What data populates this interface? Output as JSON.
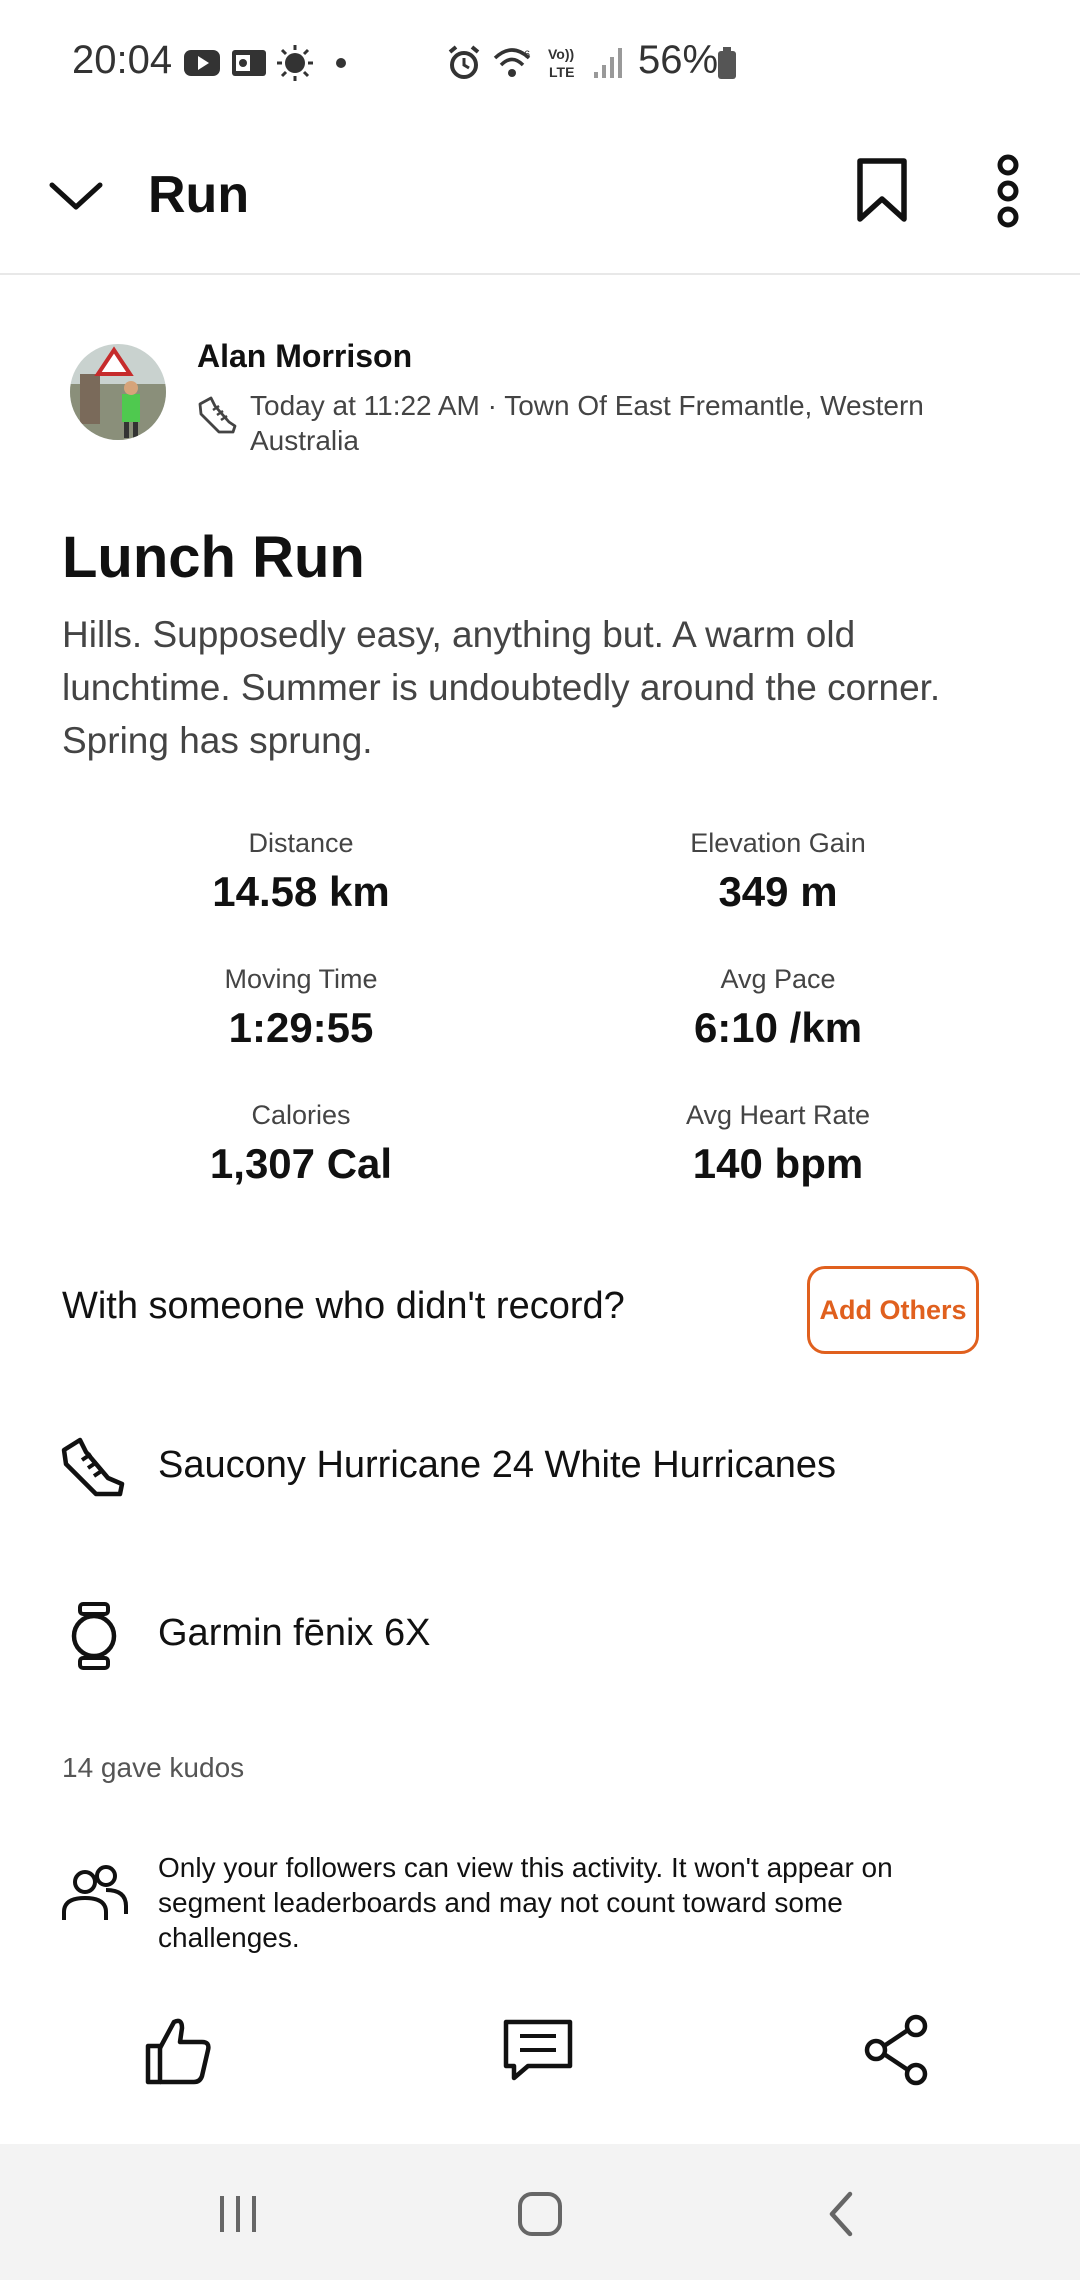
{
  "status_bar": {
    "time": "20:04",
    "battery_percent": "56%",
    "icons": [
      "youtube-icon",
      "outlook-icon",
      "weather-icon",
      "dot-icon",
      "alarm-icon",
      "wifi-icon",
      "volte-icon",
      "signal-icon",
      "battery-icon"
    ]
  },
  "header": {
    "title": "Run",
    "icons": [
      "chevron-down-icon",
      "bookmark-icon",
      "more-vertical-icon"
    ]
  },
  "athlete": {
    "name": "Alan Morrison",
    "meta": "Today at 11:22 AM · Town Of East Fremantle, Western Australia"
  },
  "activity": {
    "title": "Lunch Run",
    "description": "Hills. Supposedly easy, anything but. A warm old lunchtime. Summer is undoubtedly around the corner. Spring has sprung."
  },
  "stats": [
    {
      "label": "Distance",
      "value": "14.58 km"
    },
    {
      "label": "Elevation Gain",
      "value": "349 m"
    },
    {
      "label": "Moving Time",
      "value": "1:29:55"
    },
    {
      "label": "Avg Pace",
      "value": "6:10 /km"
    },
    {
      "label": "Calories",
      "value": "1,307 Cal"
    },
    {
      "label": "Avg Heart Rate",
      "value": "140 bpm"
    }
  ],
  "with_someone": {
    "text": "With someone who didn't record?",
    "button": "Add Others"
  },
  "gear": {
    "shoe": "Saucony Hurricane 24 White Hurricanes",
    "device": "Garmin fēnix 6X"
  },
  "kudos": "14 gave kudos",
  "privacy": "Only your followers can view this activity. It won't appear on segment leaderboards and may not count toward some challenges.",
  "actions": [
    "kudos-icon",
    "comment-icon",
    "share-icon"
  ],
  "nav": [
    "recent-apps-icon",
    "home-icon",
    "back-icon"
  ],
  "colors": {
    "accent": "#e0601e",
    "text": "#111111",
    "muted": "#444444",
    "nav_bg": "#f3f3f3"
  }
}
